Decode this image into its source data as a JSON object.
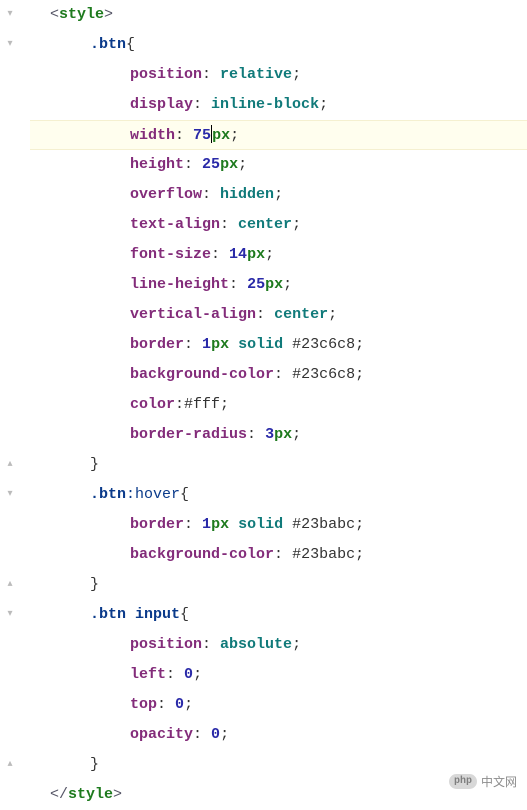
{
  "gutter_folds": [
    {
      "line": 0,
      "glyph": "▾"
    },
    {
      "line": 1,
      "glyph": "▾"
    },
    {
      "line": 15,
      "glyph": "▴"
    },
    {
      "line": 16,
      "glyph": "▾"
    },
    {
      "line": 19,
      "glyph": "▴"
    },
    {
      "line": 20,
      "glyph": "▾"
    },
    {
      "line": 25,
      "glyph": "▴"
    }
  ],
  "code": {
    "open_tag_open": "<",
    "tag_style": "style",
    "open_tag_close": ">",
    "close_tag_open": "</",
    "close_tag_close": ">",
    "selectors": {
      "btn": ".btn",
      "btn_hover_base": ".btn",
      "btn_hover_pseudo": ":hover",
      "btn_input": ".btn input"
    },
    "brace_open": "{",
    "brace_close": "}",
    "colon": ":",
    "semi": ";",
    "space": " ",
    "rules": {
      "position": "position",
      "display": "display",
      "width": "width",
      "height": "height",
      "overflow": "overflow",
      "text_align": "text-align",
      "font_size": "font-size",
      "line_height": "line-height",
      "vertical_align": "vertical-align",
      "border": "border",
      "background_color": "background-color",
      "color": "color",
      "border_radius": "border-radius",
      "left": "left",
      "top": "top",
      "opacity": "opacity"
    },
    "values": {
      "relative": "relative",
      "inline_block": "inline-block",
      "n75": "75",
      "n25": "25",
      "n25b": "25",
      "hidden": "hidden",
      "center": "center",
      "n14": "14",
      "n25c": "25",
      "center2": "center",
      "n1": "1",
      "solid": "solid",
      "hex1": "#23c6c8",
      "hex1b": "#23c6c8",
      "fff": "#fff",
      "n3": "3",
      "n1b": "1",
      "solid2": "solid",
      "hex2": "#23babc",
      "hex2b": "#23babc",
      "absolute": "absolute",
      "n0a": "0",
      "n0b": "0",
      "n0c": "0",
      "px": "px"
    }
  },
  "watermark": {
    "badge": "php",
    "text": "中文网"
  }
}
